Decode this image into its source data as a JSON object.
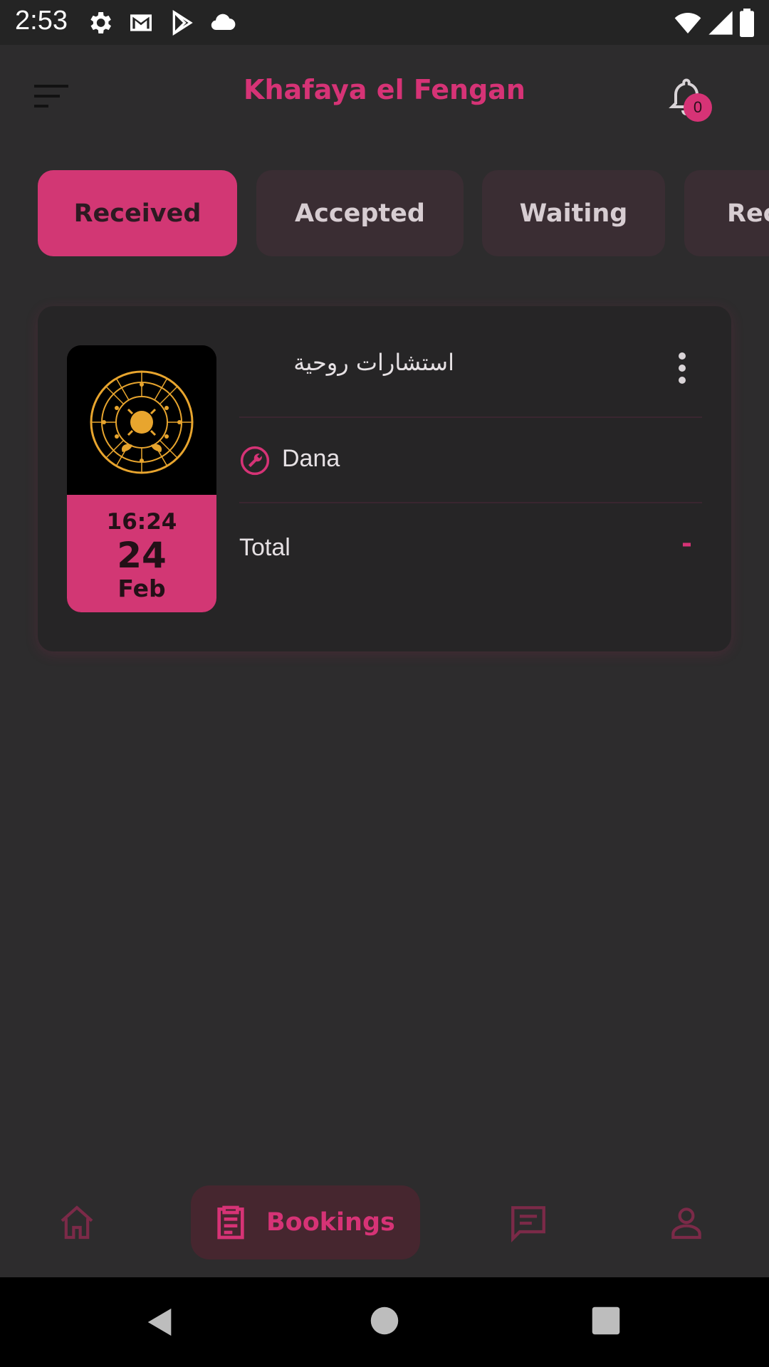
{
  "status_bar": {
    "time": "2:53"
  },
  "app_bar": {
    "title": "Khafaya el Fengan",
    "notification_count": "0"
  },
  "tabs": [
    {
      "label": "Received",
      "active": true
    },
    {
      "label": "Accepted",
      "active": false
    },
    {
      "label": "Waiting",
      "active": false
    },
    {
      "label": "Rec",
      "active": false
    }
  ],
  "booking": {
    "service": "استشارات روحية",
    "time": "16:24",
    "day": "24",
    "month": "Feb",
    "provider": "Dana",
    "total_label": "Total",
    "total_value": "-"
  },
  "bottom_nav": {
    "active_label": "Bookings"
  },
  "colors": {
    "accent": "#d63376",
    "background": "#2d2c2d",
    "card": "#262526"
  }
}
